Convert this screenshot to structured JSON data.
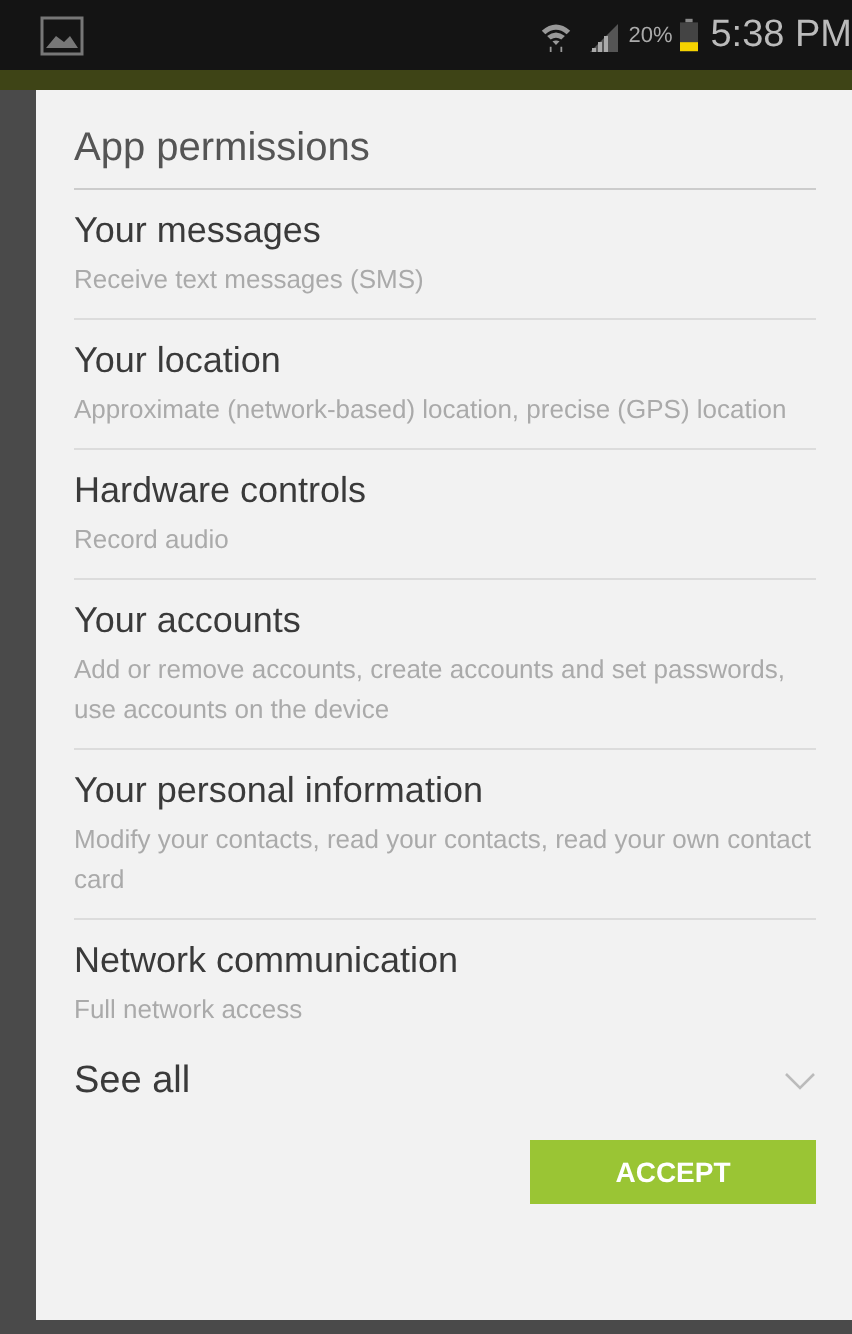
{
  "status_bar": {
    "battery_percent": "20%",
    "time": "5:38 PM"
  },
  "dialog": {
    "title": "App permissions",
    "permissions": [
      {
        "title": "Your messages",
        "description": "Receive text messages (SMS)"
      },
      {
        "title": "Your location",
        "description": "Approximate (network-based) location, precise (GPS) location"
      },
      {
        "title": "Hardware controls",
        "description": "Record audio"
      },
      {
        "title": "Your accounts",
        "description": "Add or remove accounts, create accounts and set passwords, use accounts on the device"
      },
      {
        "title": "Your personal information",
        "description": "Modify your contacts, read your contacts, read your own contact card"
      },
      {
        "title": "Network communication",
        "description": "Full network access"
      }
    ],
    "see_all": "See all",
    "accept_button": "ACCEPT"
  }
}
